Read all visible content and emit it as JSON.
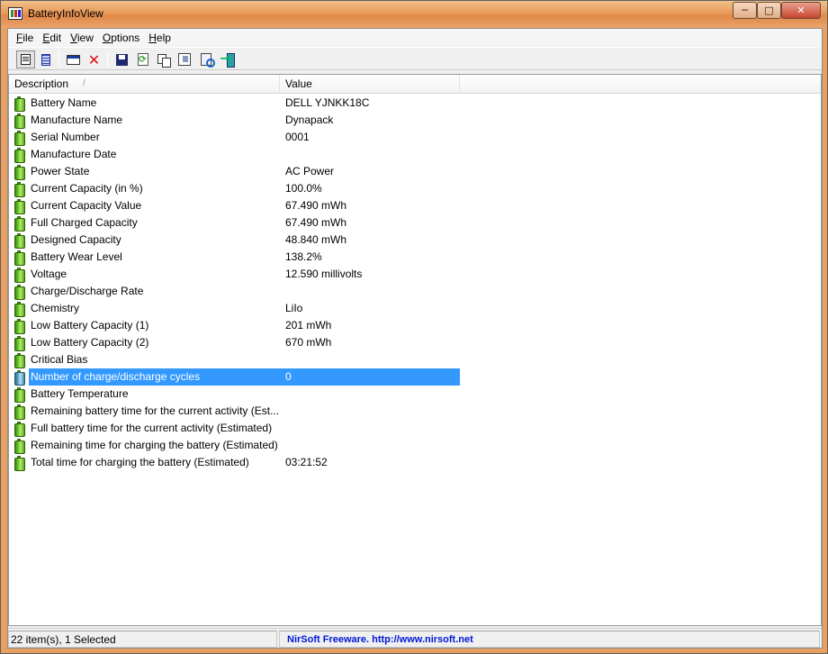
{
  "window": {
    "title": "BatteryInfoView",
    "controls": {
      "minimize": "─",
      "maximize": "□",
      "close": "✕"
    }
  },
  "menubar": [
    {
      "key": "F",
      "rest": "ile"
    },
    {
      "key": "E",
      "rest": "dit"
    },
    {
      "key": "V",
      "rest": "iew"
    },
    {
      "key": "O",
      "rest": "ptions"
    },
    {
      "key": "H",
      "rest": "elp"
    }
  ],
  "toolbar": {
    "icons": [
      "report-view-icon",
      "list-view-icon",
      "properties-icon",
      "delete-icon",
      "save-icon",
      "refresh-icon",
      "copy-icon",
      "html-report-icon",
      "find-icon",
      "exit-icon"
    ]
  },
  "columns": {
    "description": "Description",
    "value": "Value",
    "sort_arrow": "/"
  },
  "rows": [
    {
      "description": "Battery Name",
      "value": "DELL YJNKK18C"
    },
    {
      "description": "Manufacture Name",
      "value": "Dynapack"
    },
    {
      "description": "Serial Number",
      "value": "0001"
    },
    {
      "description": "Manufacture Date",
      "value": ""
    },
    {
      "description": "Power State",
      "value": "AC Power"
    },
    {
      "description": "Current Capacity (in %)",
      "value": "100.0%"
    },
    {
      "description": "Current Capacity Value",
      "value": "67.490 mWh"
    },
    {
      "description": "Full Charged Capacity",
      "value": "67.490 mWh"
    },
    {
      "description": "Designed Capacity",
      "value": "48.840 mWh"
    },
    {
      "description": "Battery Wear Level",
      "value": "138.2%"
    },
    {
      "description": "Voltage",
      "value": "12.590 millivolts"
    },
    {
      "description": "Charge/Discharge Rate",
      "value": ""
    },
    {
      "description": "Chemistry",
      "value": "LiIo"
    },
    {
      "description": "Low Battery Capacity (1)",
      "value": "201 mWh"
    },
    {
      "description": "Low Battery Capacity (2)",
      "value": "670 mWh"
    },
    {
      "description": "Critical Bias",
      "value": ""
    },
    {
      "description": "Number of charge/discharge cycles",
      "value": "0",
      "selected": true
    },
    {
      "description": "Battery Temperature",
      "value": ""
    },
    {
      "description": "Remaining battery time for the current activity (Est...",
      "value": ""
    },
    {
      "description": "Full battery time for the current activity (Estimated)",
      "value": ""
    },
    {
      "description": "Remaining time for charging the battery (Estimated)",
      "value": ""
    },
    {
      "description": "Total  time for charging the battery (Estimated)",
      "value": "03:21:52"
    }
  ],
  "statusbar": {
    "items": "22 item(s), 1 Selected",
    "credit": "NirSoft Freeware.  http://www.nirsoft.net"
  },
  "colors": {
    "selection": "#3399ff",
    "credit_text": "#0018d8",
    "title_bar": "#e89a58"
  }
}
